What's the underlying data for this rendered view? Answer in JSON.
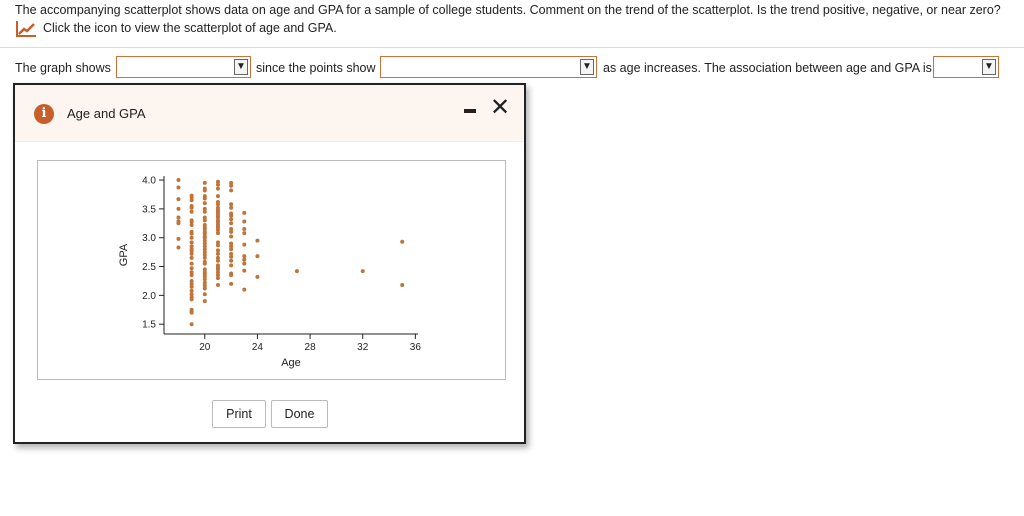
{
  "question": {
    "line1": "The accompanying scatterplot shows data on age and GPA for a sample of college students. Comment on the trend of the scatterplot. Is the trend positive, negative, or near zero?",
    "line2": "Click the icon to view the scatterplot of age and GPA."
  },
  "sentence": {
    "part1": "The graph shows",
    "part2": "since the points show",
    "part3": "as age increases. The association between age and GPA is",
    "dropdown1": "",
    "dropdown2": "",
    "dropdown3": ""
  },
  "dialog": {
    "title": "Age and GPA",
    "print": "Print",
    "done": "Done"
  },
  "colors": {
    "accent": "#c65f2a",
    "points": "#c0743a"
  },
  "chart_data": {
    "type": "scatter",
    "title": "",
    "xlabel": "Age",
    "ylabel": "GPA",
    "xlim": [
      16.9,
      36.2
    ],
    "ylim": [
      1.33,
      4.07
    ],
    "xticks": [
      20,
      24,
      28,
      32,
      36
    ],
    "yticks": [
      "1.5",
      "2.0",
      "2.5",
      "3.0",
      "3.5",
      "4.0"
    ],
    "groups": [
      {
        "x": 18,
        "y": [
          4.0,
          3.87,
          3.67,
          3.5,
          3.35,
          3.28,
          3.25,
          2.98,
          2.83
        ]
      },
      {
        "x": 19,
        "y": [
          3.73,
          3.7,
          3.65,
          3.55,
          3.52,
          3.45,
          3.3,
          3.27,
          3.22,
          3.1,
          3.07,
          3.0,
          2.92,
          2.85,
          2.8,
          2.77,
          2.72,
          2.65,
          2.55,
          2.47,
          2.4,
          2.35,
          2.25,
          2.2,
          2.15,
          2.08,
          2.02,
          1.97,
          1.93,
          1.75,
          1.72,
          1.7,
          1.5
        ]
      },
      {
        "x": 20,
        "y": [
          3.95,
          3.85,
          3.82,
          3.72,
          3.68,
          3.6,
          3.5,
          3.45,
          3.35,
          3.3,
          3.22,
          3.18,
          3.15,
          3.1,
          3.07,
          3.02,
          3.0,
          2.95,
          2.9,
          2.85,
          2.8,
          2.75,
          2.7,
          2.65,
          2.58,
          2.55,
          2.45,
          2.4,
          2.37,
          2.33,
          2.28,
          2.22,
          2.17,
          2.12,
          2.02,
          1.9
        ]
      },
      {
        "x": 21,
        "y": [
          3.97,
          3.92,
          3.85,
          3.72,
          3.62,
          3.58,
          3.52,
          3.48,
          3.45,
          3.42,
          3.38,
          3.35,
          3.3,
          3.27,
          3.23,
          3.2,
          3.17,
          3.13,
          3.08,
          2.92,
          2.87,
          2.78,
          2.72,
          2.65,
          2.6,
          2.52,
          2.48,
          2.45,
          2.4,
          2.35,
          2.3,
          2.18
        ]
      },
      {
        "x": 22,
        "y": [
          3.95,
          3.9,
          3.82,
          3.58,
          3.52,
          3.42,
          3.38,
          3.32,
          3.25,
          3.15,
          3.1,
          3.02,
          2.9,
          2.85,
          2.8,
          2.72,
          2.67,
          2.6,
          2.52,
          2.38,
          2.35,
          2.2
        ]
      },
      {
        "x": 23,
        "y": [
          3.43,
          3.28,
          3.15,
          3.08,
          2.88,
          2.68,
          2.62,
          2.55,
          2.43,
          2.1
        ]
      },
      {
        "x": 24,
        "y": [
          2.95,
          2.68,
          2.32
        ]
      },
      {
        "x": 27,
        "y": [
          2.42
        ]
      },
      {
        "x": 32,
        "y": [
          2.42
        ]
      },
      {
        "x": 35,
        "y": [
          2.93,
          2.18
        ]
      }
    ]
  }
}
